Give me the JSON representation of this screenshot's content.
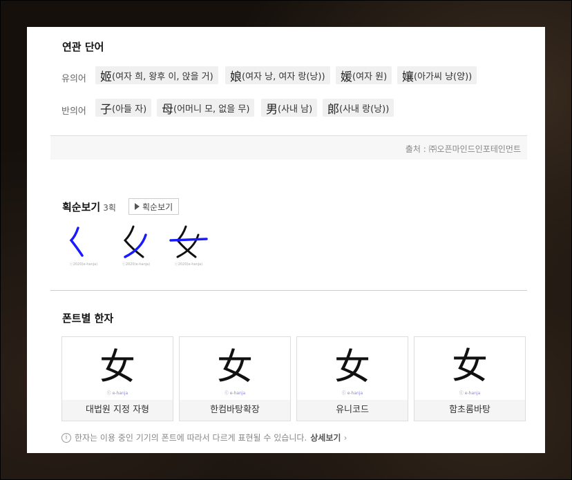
{
  "related": {
    "title": "연관 단어",
    "synonym_label": "유의어",
    "synonyms": [
      {
        "han": "姬",
        "desc": "(여자 희, 왕후 이, 앉을 거)"
      },
      {
        "han": "娘",
        "desc": "(여자 낭, 여자 랑(낭))"
      },
      {
        "han": "媛",
        "desc": "(여자 원)"
      },
      {
        "han": "孃",
        "desc": "(아가씨 냥(양))"
      }
    ],
    "antonym_label": "반의어",
    "antonyms": [
      {
        "han": "子",
        "desc": "(아들 자)"
      },
      {
        "han": "母",
        "desc": "(어머니 모, 없을 무)"
      },
      {
        "han": "男",
        "desc": "(사내 남)"
      },
      {
        "han": "郞",
        "desc": "(사내 랑(낭))"
      }
    ],
    "source": "출처 : ㈜오픈마인드인포테인먼트"
  },
  "strokes": {
    "title": "획순보기",
    "count": "3획",
    "button_label": "획순보기",
    "frames": [
      "く",
      "女",
      "女"
    ],
    "frame_caption": "ⓒ2020(e-hanja)"
  },
  "fonts": {
    "title": "폰트별 한자",
    "glyph": "女",
    "glyph_caption": "ⓒ e-hanja",
    "cards": [
      {
        "name": "대법원 지정 자형"
      },
      {
        "name": "한컴바탕확장"
      },
      {
        "name": "유니코드"
      },
      {
        "name": "함초롬바탕"
      }
    ],
    "notice": "한자는 이용 중인 기기의 폰트에 따라서 다르게 표현될 수 있습니다.",
    "detail_link": "상세보기"
  },
  "colors": {
    "stroke_color": "#1a1aff",
    "chip_bg": "#f0f0f0"
  }
}
